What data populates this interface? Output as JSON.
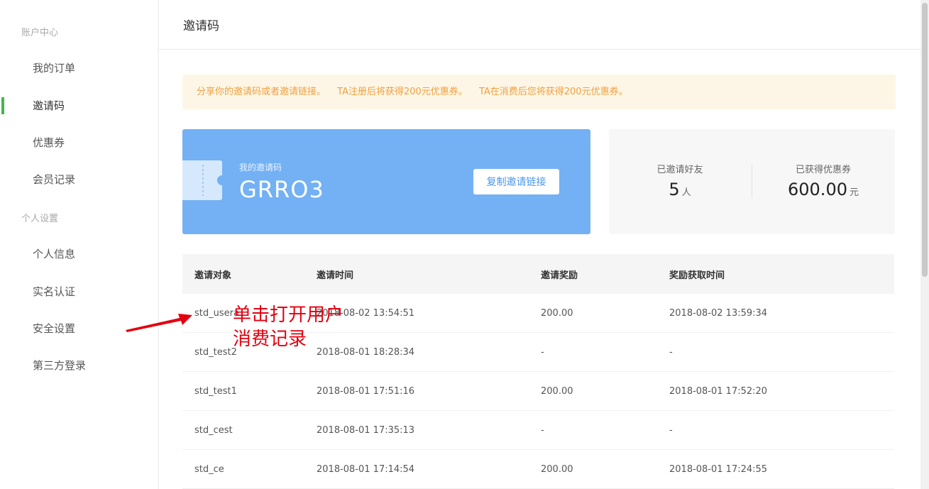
{
  "sidebar": {
    "groups": [
      {
        "title": "账户中心",
        "items": [
          "我的订单",
          "邀请码",
          "优惠券",
          "会员记录"
        ]
      },
      {
        "title": "个人设置",
        "items": [
          "个人信息",
          "实名认证",
          "安全设置",
          "第三方登录"
        ]
      }
    ],
    "active_item": "邀请码",
    "accent_color": "#43b650"
  },
  "header": {
    "title": "邀请码"
  },
  "notice": {
    "parts": [
      "分享你的邀请码或者邀请链接。",
      "TA注册后将获得200元优惠券。",
      "TA在消费后您将获得200元优惠券。"
    ],
    "color": "#f0a040"
  },
  "code_card": {
    "label": "我的邀请码",
    "code": "GRRO3",
    "copy_button": "复制邀请链接",
    "color": "#73b1f4"
  },
  "stats": {
    "invited": {
      "label": "已邀请好友",
      "value": "5",
      "unit": "人"
    },
    "coupons": {
      "label": "已获得优惠券",
      "value": "600.00",
      "unit": "元"
    }
  },
  "table": {
    "headers": [
      "邀请对象",
      "邀请时间",
      "邀请奖励",
      "奖励获取时间"
    ],
    "rows": [
      [
        "std_usera",
        "2018-08-02 13:54:51",
        "200.00",
        "2018-08-02 13:59:34"
      ],
      [
        "std_test2",
        "2018-08-01 18:28:34",
        "-",
        "-"
      ],
      [
        "std_test1",
        "2018-08-01 17:51:16",
        "200.00",
        "2018-08-01 17:52:20"
      ],
      [
        "std_cest",
        "2018-08-01 17:35:13",
        "-",
        "-"
      ],
      [
        "std_ce",
        "2018-08-01 17:14:54",
        "200.00",
        "2018-08-01 17:24:55"
      ]
    ]
  },
  "annotation": {
    "lines": [
      "单击打开用户",
      "消费记录"
    ],
    "color": "#e3000f"
  }
}
